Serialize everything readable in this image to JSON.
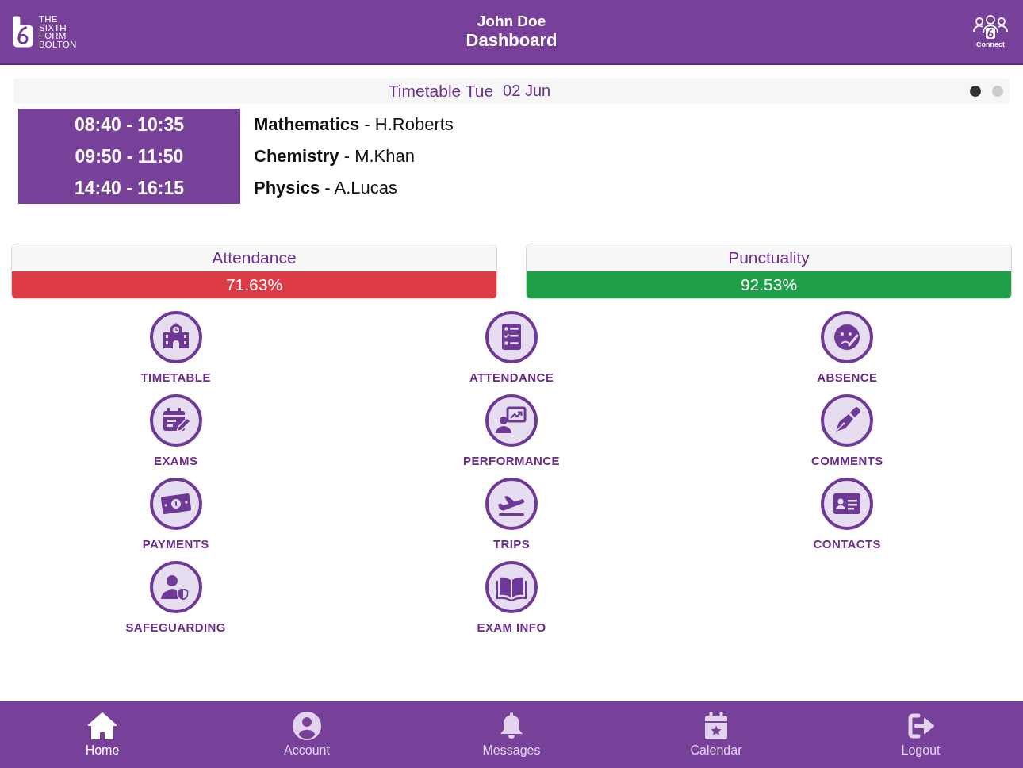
{
  "header": {
    "logo_lines": [
      "THE",
      "SIXTH",
      "FORM",
      "BOLTON"
    ],
    "user_name": "John Doe",
    "title": "Dashboard",
    "connect_label": "Connect"
  },
  "timetable": {
    "title": "Timetable Tue",
    "date": "02 Jun",
    "pages": [
      {
        "selected": true
      },
      {
        "selected": false
      }
    ],
    "lessons": [
      {
        "time": "08:40 - 10:35",
        "text": "**Mathematics** - H.Roberts"
      },
      {
        "time": "09:50 - 11:50",
        "text": "**Chemistry** - M.Khan"
      },
      {
        "time": "14:40 - 16:15",
        "text": "**Physics** - A.Lucas"
      }
    ]
  },
  "stats": [
    {
      "label": "Attendance",
      "value": "71.63%",
      "color": "#dc3a45"
    },
    {
      "label": "Punctuality",
      "value": "92.53%",
      "color": "#1e9f48"
    }
  ],
  "tiles": [
    {
      "label": "TIMETABLE"
    },
    {
      "label": "ATTENDANCE"
    },
    {
      "label": "ABSENCE"
    },
    {
      "label": "EXAMS"
    },
    {
      "label": "PERFORMANCE"
    },
    {
      "label": "COMMENTS"
    },
    {
      "label": "PAYMENTS"
    },
    {
      "label": "TRIPS"
    },
    {
      "label": "CONTACTS"
    },
    {
      "label": "SAFEGUARDING"
    },
    {
      "label": "EXAM INFO"
    }
  ],
  "nav": [
    {
      "label": "Home",
      "selected": true
    },
    {
      "label": "Account",
      "selected": false
    },
    {
      "label": "Messages",
      "selected": false
    },
    {
      "label": "Calendar",
      "selected": false
    },
    {
      "label": "Logout",
      "selected": false
    }
  ]
}
